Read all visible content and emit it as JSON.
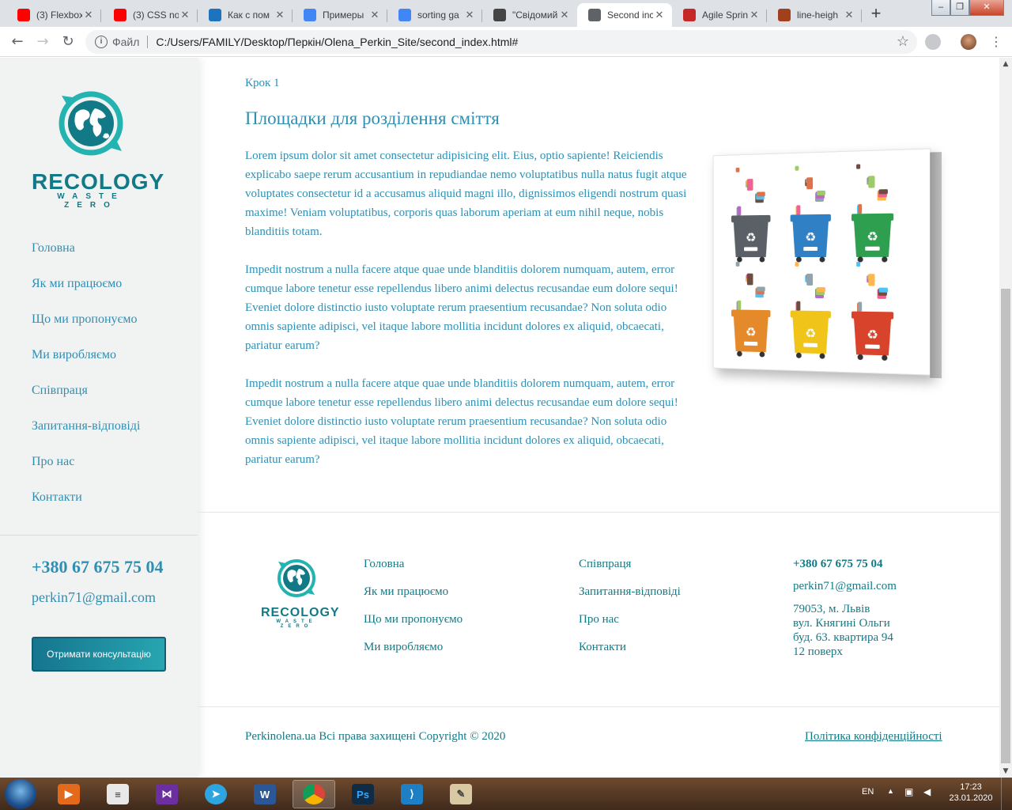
{
  "browser": {
    "tabs": [
      {
        "title": "(3) Flexbox",
        "icon": "youtube-icon",
        "color": "#ff0000"
      },
      {
        "title": "(3) CSS no",
        "icon": "youtube-icon",
        "color": "#ff0000"
      },
      {
        "title": "Как с пом",
        "icon": "site-icon",
        "color": "#1e73be"
      },
      {
        "title": "Примеры",
        "icon": "google-icon",
        "color": "#4285f4"
      },
      {
        "title": "sorting ga",
        "icon": "google-icon",
        "color": "#4285f4"
      },
      {
        "title": "\"Свідомий",
        "icon": "doc-icon",
        "color": "#444444"
      },
      {
        "title": "Second inc",
        "icon": "globe-icon",
        "color": "#5f6368"
      },
      {
        "title": "Agile Sprin",
        "icon": "agile-icon",
        "color": "#c62828"
      },
      {
        "title": "line-heigh",
        "icon": "brick-icon",
        "color": "#a0401c"
      }
    ],
    "address": {
      "scheme": "Файл",
      "url": "C:/Users/FAMILY/Desktop/Перкін/Olena_Perkin_Site/second_index.html#"
    }
  },
  "sidebar": {
    "brand": "RECOLOGY",
    "tagline": "WASTE ZERO",
    "nav": [
      "Головна",
      "Як ми працюємо",
      "Що ми пропонуємо",
      "Ми виробляємо",
      "Співпраця",
      "Запитання-відповіді",
      "Про нас",
      "Контакти"
    ],
    "phone": "+380 67 675 75 04",
    "email": "perkin71@gmail.com",
    "cta": "Отримати консультацію"
  },
  "main": {
    "step": "Крок 1",
    "heading": "Площадки для розділення сміття",
    "paragraphs": [
      "Lorem ipsum dolor sit amet consectetur adipisicing elit. Eius, optio sapiente! Reiciendis explicabo saepe rerum accusantium in repudiandae nemo voluptatibus nulla natus fugit atque voluptates consectetur id a accusamus aliquid magni illo, dignissimos eligendi nostrum quasi maxime! Veniam voluptatibus, corporis quas laborum aperiam at eum nihil neque, nobis blanditiis totam.",
      "Impedit nostrum a nulla facere atque quae unde blanditiis dolorem numquam, autem, error cumque labore tenetur esse repellendus libero animi delectus recusandae eum dolore sequi! Eveniet dolore distinctio iusto voluptate rerum praesentium recusandae? Non soluta odio omnis sapiente adipisci, vel itaque labore mollitia incidunt dolores ex aliquid, obcaecati, pariatur earum?",
      "Impedit nostrum a nulla facere atque quae unde blanditiis dolorem numquam, autem, error cumque labore tenetur esse repellendus libero animi delectus recusandae eum dolore sequi! Eveniet dolore distinctio iusto voluptate rerum praesentium recusandae? Non soluta odio omnis sapiente adipisci, vel itaque labore mollitia incidunt dolores ex aliquid, obcaecati, pariatur earum?"
    ],
    "bin_colors": [
      "#5a6066",
      "#2f80c4",
      "#2e9e4f",
      "#e58a2b",
      "#f0c419",
      "#d8432b"
    ]
  },
  "footer": {
    "brand": "RECOLOGY",
    "tagline": "WASTE ZERO",
    "col1": [
      "Головна",
      "Як ми працюємо",
      "Що ми пропонуємо",
      "Ми виробляємо"
    ],
    "col2": [
      "Співпраця",
      "Запитання-відповіді",
      "Про нас",
      "Контакти"
    ],
    "phone": "+380 67 675 75 04",
    "email": "perkin71@gmail.com",
    "address": [
      "79053, м. Львів",
      "вул. Княгині Ольги",
      "буд. 63. квартира 94",
      "12 поверх"
    ],
    "copyright": "Perkinolena.ua Всі права захищені Copyright © 2020",
    "policy": "Політика конфіденційності"
  },
  "taskbar": {
    "language": "EN",
    "time": "17:23",
    "date": "23.01.2020"
  },
  "colors": {
    "accent": "#2f8fb3",
    "brand": "#127a86"
  }
}
